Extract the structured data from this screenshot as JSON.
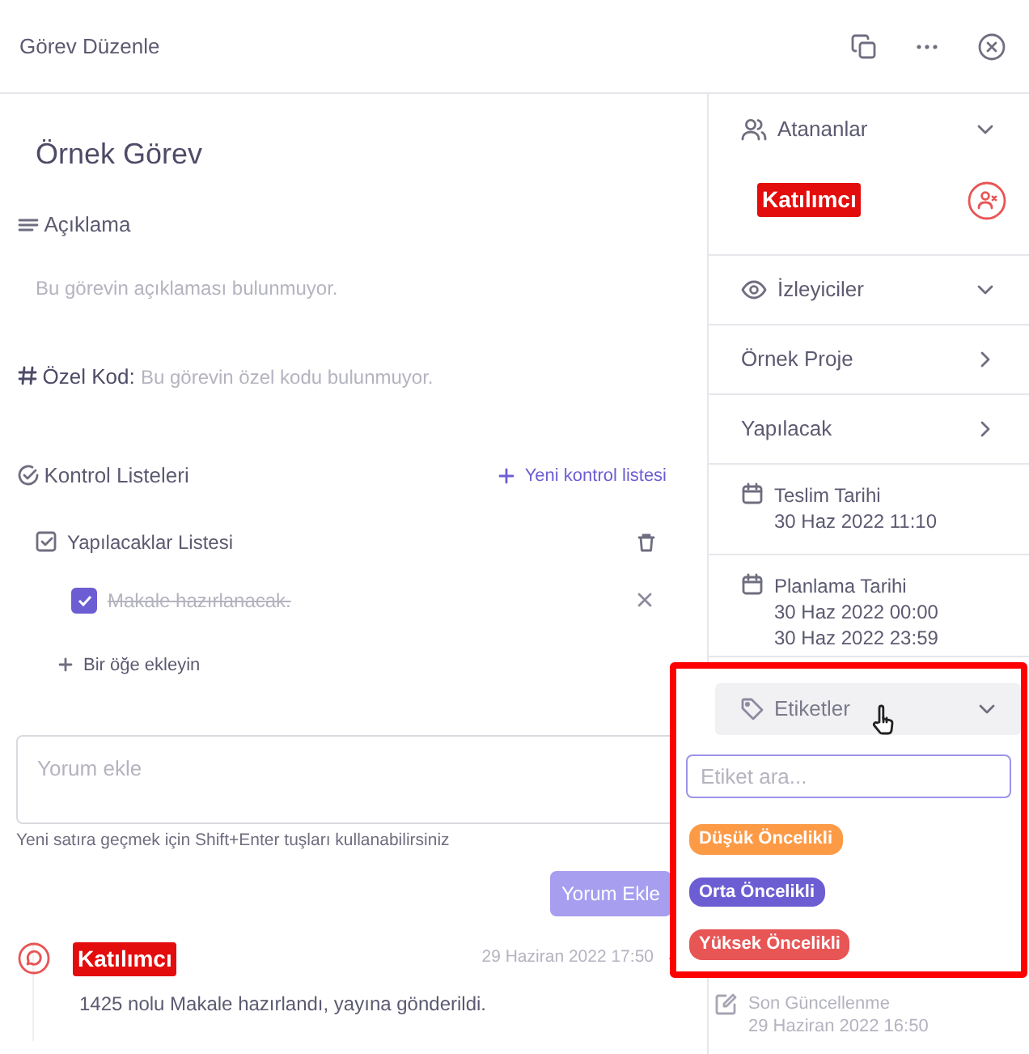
{
  "header": {
    "title": "Görev Düzenle"
  },
  "task": {
    "title": "Örnek Görev",
    "description_label": "Açıklama",
    "description": "Bu görevin açıklaması bulunmuyor.",
    "code_label": "Özel Kod:",
    "code": "Bu görevin özel kodu bulunmuyor."
  },
  "checklists": {
    "title": "Kontrol Listeleri",
    "new_button": "Yeni kontrol listesi",
    "lists": [
      {
        "name": "Yapılacaklar Listesi",
        "add_item": "Bir öğe ekleyin",
        "items": [
          {
            "text": "Makale hazırlanacak.",
            "checked": true
          }
        ]
      }
    ]
  },
  "comment_form": {
    "placeholder": "Yorum ekle",
    "hint": "Yeni satıra geçmek için Shift+Enter tuşları kullanabilirsiniz",
    "button": "Yorum Ekle"
  },
  "comments": [
    {
      "author": "Katılımcı",
      "time": "29 Haziran 2022 17:50",
      "text": "1425 nolu Makale hazırlandı, yayına gönderildi."
    }
  ],
  "sidebar": {
    "assignees": {
      "label": "Atananlar",
      "people": [
        "Katılımcı"
      ]
    },
    "watchers": {
      "label": "İzleyiciler"
    },
    "project": {
      "label": "Örnek Proje"
    },
    "status": {
      "label": "Yapılacak"
    },
    "due": {
      "label": "Teslim Tarihi",
      "values": [
        "30 Haz 2022 11:10"
      ]
    },
    "planning": {
      "label": "Planlama Tarihi",
      "values": [
        "30 Haz 2022 00:00",
        "30 Haz 2022 23:59"
      ]
    },
    "last_updated": {
      "label": "Son Güncellenme",
      "value": "29 Haziran 2022 16:50"
    }
  },
  "tag_dropdown": {
    "label": "Etiketler",
    "placeholder": "Etiket ara...",
    "tags": [
      {
        "name": "Düşük Öncelikli",
        "color": "#fd9a46"
      },
      {
        "name": "Orta Öncelikli",
        "color": "#6c5dd3"
      },
      {
        "name": "Yüksek Öncelikli",
        "color": "#e85555"
      }
    ]
  }
}
